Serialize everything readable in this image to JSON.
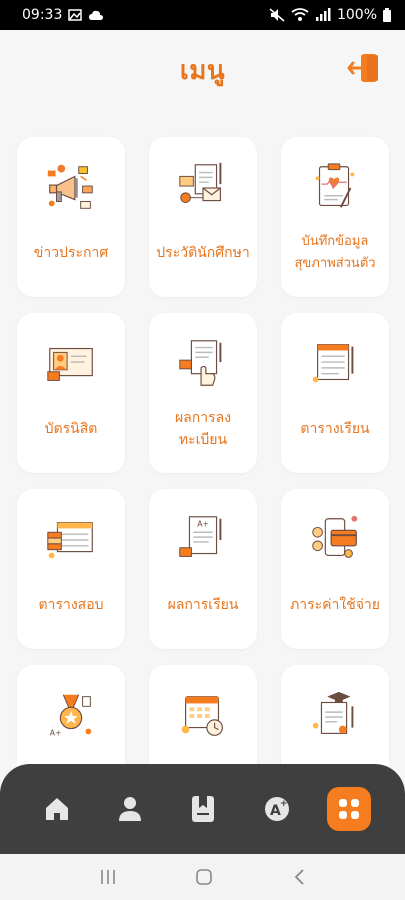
{
  "status": {
    "time": "09:33",
    "battery": "100%"
  },
  "header": {
    "title": "เมนู"
  },
  "menu": [
    {
      "label": "ข่าวประกาศ",
      "icon": "megaphone-icon"
    },
    {
      "label": "ประวัตินักศึกษา",
      "icon": "student-profile-icon"
    },
    {
      "label": "บันทึกข้อมูล\nสุขภาพส่วนตัว",
      "icon": "health-clipboard-icon"
    },
    {
      "label": "บัตรนิสิต",
      "icon": "id-card-icon"
    },
    {
      "label": "ผลการลง\nทะเบียน",
      "icon": "registration-result-icon"
    },
    {
      "label": "ตารางเรียน",
      "icon": "class-schedule-icon"
    },
    {
      "label": "ตารางสอบ",
      "icon": "exam-schedule-icon"
    },
    {
      "label": "ผลการเรียน",
      "icon": "grade-result-icon"
    },
    {
      "label": "ภาระค่าใช้จ่าย",
      "icon": "payment-icon"
    },
    {
      "label": "",
      "icon": "medal-award-icon"
    },
    {
      "label": "",
      "icon": "calendar-icon"
    },
    {
      "label": "",
      "icon": "graduation-certificate-icon"
    }
  ],
  "nav": [
    {
      "name": "home-icon"
    },
    {
      "name": "profile-icon"
    },
    {
      "name": "book-icon"
    },
    {
      "name": "grade-icon"
    },
    {
      "name": "menu-grid-icon",
      "active": true
    }
  ],
  "colors": {
    "accent": "#e8741c",
    "navbar": "#3f3f3f",
    "active": "#f57c1f"
  }
}
